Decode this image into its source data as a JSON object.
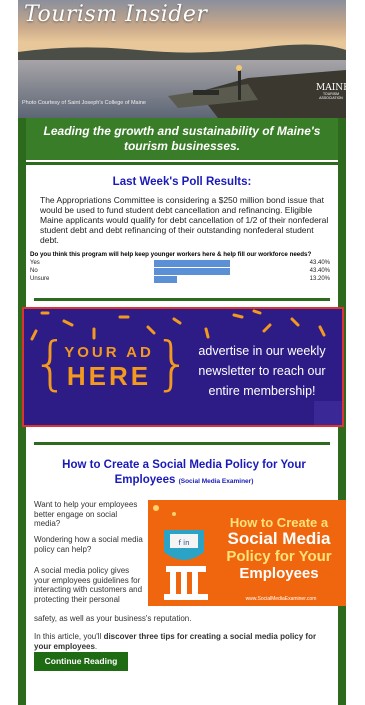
{
  "header": {
    "title": "Tourism Insider",
    "photo_credit": "Photo Courtesy of Saint Joseph's College of Maine",
    "logo_text": "MAINE",
    "logo_sub": "TOURISM ASSOCIATION",
    "tagline": "Leading the growth and sustainability of Maine's tourism businesses."
  },
  "poll": {
    "title": "Last Week's Poll Results:",
    "intro": "The Appropriations Committee is considering a $250 million bond issue that would be used to fund student debt cancellation and refinancing. Eligible Maine applicants would qualify for debt cancellation of 1/2 of their nonfederal student debt and debt refinancing of their outstanding nonfederal student debt.",
    "question": "Do you think this program will help keep younger workers here & help fill our workforce needs?",
    "options": [
      {
        "label": "Yes",
        "percent_text": "43.40%",
        "value": 43.4
      },
      {
        "label": "No",
        "percent_text": "43.40%",
        "value": 43.4
      },
      {
        "label": "Unsure",
        "percent_text": "13.20%",
        "value": 13.2
      }
    ],
    "bar_color": "#5b8fd6"
  },
  "ad": {
    "line1": "YOUR AD",
    "line2": "HERE",
    "text": "advertise in our weekly newsletter to reach our entire membership!",
    "bg_color": "#2e1c86",
    "accent_color": "#f39a1e"
  },
  "article": {
    "title": "How to Create a Social Media Policy for Your Employees",
    "source": "(Social Media Examiner)",
    "p1": "Want to help your employees better engage on social media?",
    "p2": "Wondering how a social media policy can help?",
    "p3a": "A social media policy gives your employees guidelines for interacting with customers and protecting their personal",
    "p3b": "safety, as well as your business's reputation.",
    "p4_pre": "In this article, you'll ",
    "p4_bold": "discover three tips for creating a social media policy for your employees",
    "p4_post": ".",
    "image_line1": "How to Create a",
    "image_line2": "Social Media",
    "image_line3": "Policy for Your",
    "image_line4": "Employees",
    "image_url": "www.SocialMediaExaminer.com",
    "button_label": "Continue Reading"
  },
  "colors": {
    "brand_green": "#2d6a1e",
    "link_blue": "#1a1ab8",
    "ad_border": "#dd3333"
  }
}
